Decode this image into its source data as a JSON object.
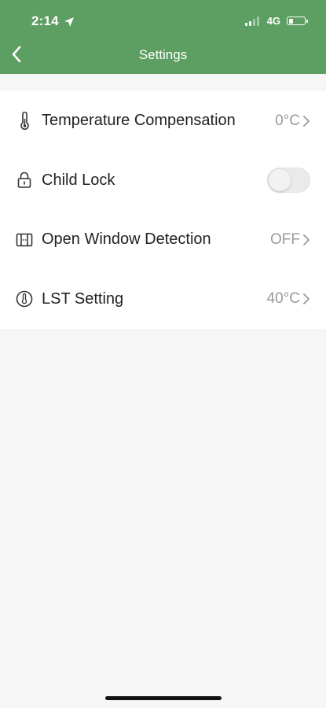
{
  "status_bar": {
    "time": "2:14",
    "network": "4G",
    "location_icon": "location-arrow-icon",
    "signal_bars_active": 2,
    "signal_bars_total": 4,
    "battery_level": 0.25
  },
  "header": {
    "title": "Settings",
    "back_icon": "chevron-left-icon",
    "background_color": "#5d9e62"
  },
  "settings": [
    {
      "id": "temperature-compensation",
      "icon": "thermometer-icon",
      "label": "Temperature Compensation",
      "value": "0°C",
      "type": "link"
    },
    {
      "id": "child-lock",
      "icon": "lock-icon",
      "label": "Child Lock",
      "value": "",
      "type": "toggle",
      "toggle_on": false
    },
    {
      "id": "open-window-detection",
      "icon": "window-icon",
      "label": "Open Window Detection",
      "value": "OFF",
      "type": "link"
    },
    {
      "id": "lst-setting",
      "icon": "thermometer-circle-icon",
      "label": "LST Setting",
      "value": "40°C",
      "type": "link"
    }
  ]
}
